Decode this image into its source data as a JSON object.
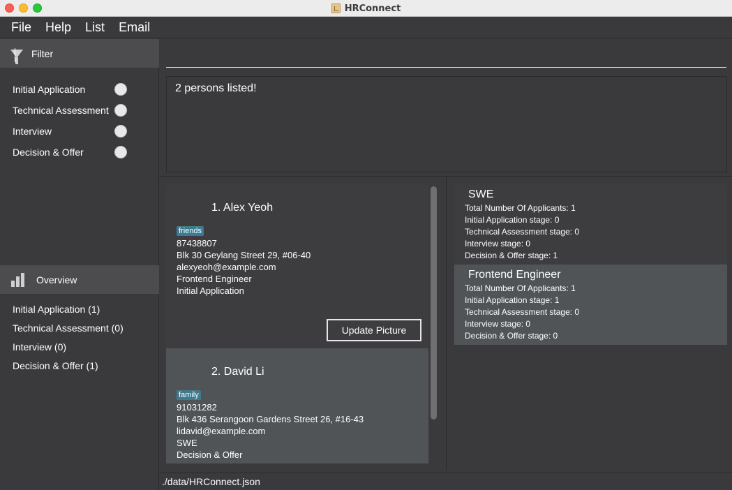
{
  "window": {
    "title": "HRConnect"
  },
  "menu": {
    "items": [
      "File",
      "Help",
      "List",
      "Email"
    ]
  },
  "sidebar": {
    "filter_label": "Filter",
    "filters": [
      "Initial Application",
      "Technical Assessment",
      "Interview",
      "Decision & Offer"
    ],
    "overview_label": "Overview",
    "overview": [
      "Initial Application (1)",
      "Technical Assessment (0)",
      "Interview (0)",
      "Decision & Offer (1)"
    ]
  },
  "command": {
    "value": "",
    "placeholder": ""
  },
  "result": {
    "message": "2 persons listed!"
  },
  "persons": [
    {
      "name": "1.  Alex Yeoh",
      "tag": "friends",
      "phone": "87438807",
      "address": "Blk 30 Geylang Street 29, #06-40",
      "email": "alexyeoh@example.com",
      "role": "Frontend Engineer",
      "stage": "Initial Application",
      "button": "Update Picture"
    },
    {
      "name": "2.  David Li",
      "tag": "family",
      "phone": "91031282",
      "address": "Blk 436 Serangoon Gardens Street 26, #16-43",
      "email": "lidavid@example.com",
      "role": "SWE",
      "stage": "Decision & Offer"
    }
  ],
  "jobs": [
    {
      "title": "SWE",
      "lines": [
        "Total Number Of Applicants: 1",
        "Initial Application stage: 0",
        "Technical Assessment stage: 0",
        "Interview stage: 0",
        "Decision & Offer stage: 1"
      ]
    },
    {
      "title": "Frontend Engineer",
      "lines": [
        "Total Number Of Applicants: 1",
        "Initial Application stage: 1",
        "Technical Assessment stage: 0",
        "Interview stage: 0",
        "Decision & Offer stage: 0"
      ]
    }
  ],
  "status": {
    "path": "./data/HRConnect.json"
  },
  "colors": {
    "tag": "#3e7b91",
    "selected_card": "#515457",
    "background": "#3a3a3c"
  }
}
